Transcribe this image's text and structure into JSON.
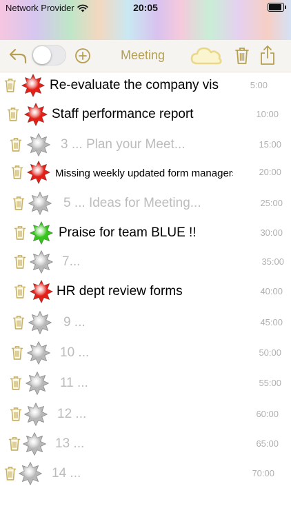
{
  "status_bar": {
    "carrier": "Network Provider",
    "time": "20:05"
  },
  "toolbar": {
    "title": "Meeting",
    "toggle_on": false,
    "accent_color": "#b59f52",
    "icons": [
      "back-arrow-icon",
      "add-circle-icon",
      "cloud-icon",
      "trash-icon",
      "share-icon"
    ]
  },
  "colors": {
    "red_star": "#e32018",
    "green_star": "#35c51b",
    "gray_star": "#b8b8b8",
    "placeholder_text": "#bcbcbc",
    "time_text": "#b0b0b0"
  },
  "items": [
    {
      "text": "Re-evaluate the company vision",
      "time": "5:00",
      "star": "red",
      "placeholder": false
    },
    {
      "text": "Staff performance report",
      "time": "10:00",
      "star": "red",
      "placeholder": false
    },
    {
      "text": "3 ... Plan your Meet...",
      "time": "15:00",
      "star": "gray",
      "placeholder": true
    },
    {
      "text": "Missing weekly updated form managers",
      "time": "20:00",
      "star": "red",
      "placeholder": false
    },
    {
      "text": "5 ... Ideas for Meeting...",
      "time": "25:00",
      "star": "gray",
      "placeholder": true
    },
    {
      "text": "Praise for team BLUE !!",
      "time": "30:00",
      "star": "green",
      "placeholder": false
    },
    {
      "text": "7...",
      "time": "35:00",
      "star": "gray",
      "placeholder": true
    },
    {
      "text": "HR dept review forms",
      "time": "40:00",
      "star": "red",
      "placeholder": false
    },
    {
      "text": "9 ...",
      "time": "45:00",
      "star": "gray",
      "placeholder": true
    },
    {
      "text": "10 ...",
      "time": "50:00",
      "star": "gray",
      "placeholder": true
    },
    {
      "text": "11 ...",
      "time": "55:00",
      "star": "gray",
      "placeholder": true
    },
    {
      "text": "12 ...",
      "time": "60:00",
      "star": "gray",
      "placeholder": true
    },
    {
      "text": "13 ...",
      "time": "65:00",
      "star": "gray",
      "placeholder": true
    },
    {
      "text": "14 ...",
      "time": "70:00",
      "star": "gray",
      "placeholder": true
    }
  ]
}
